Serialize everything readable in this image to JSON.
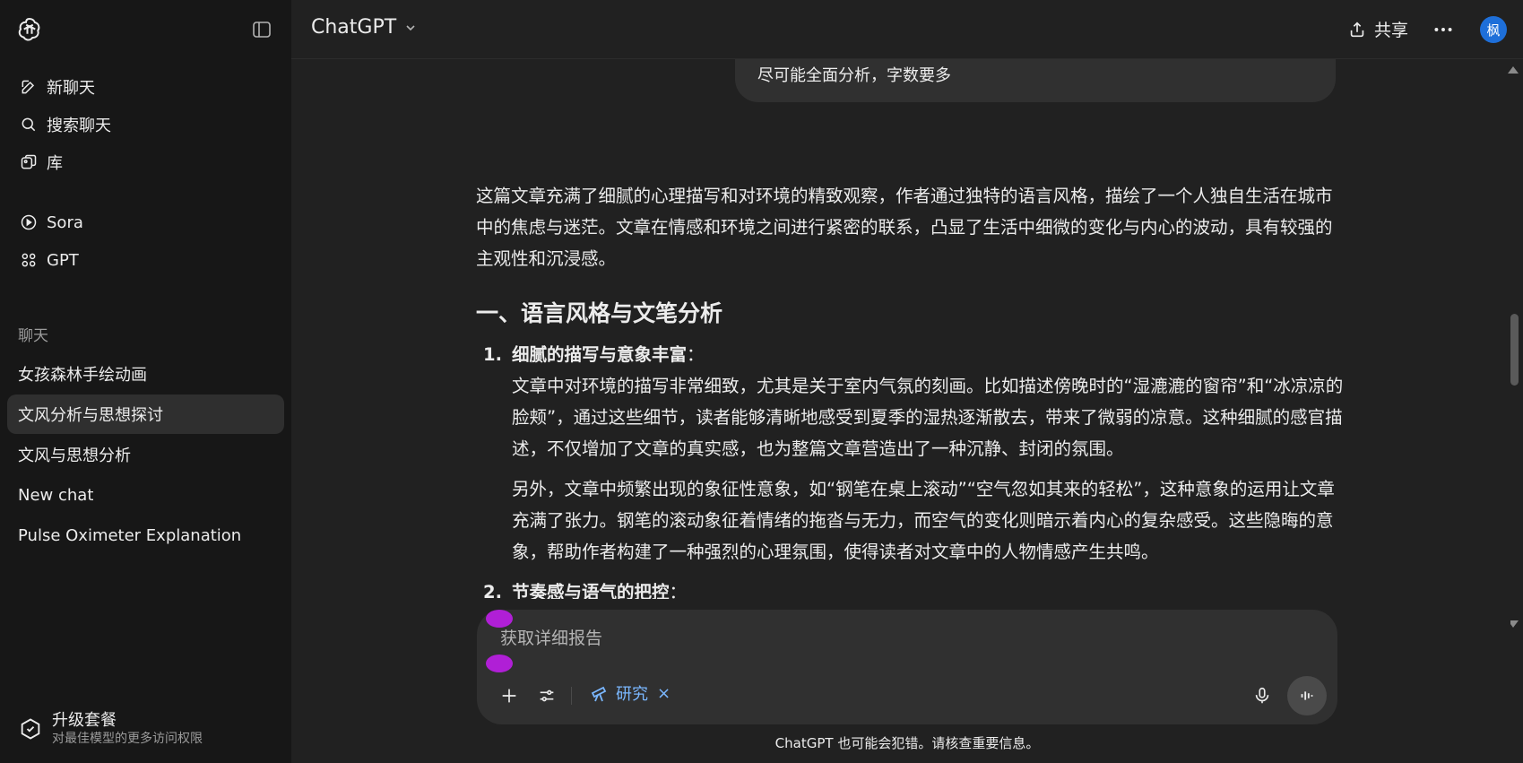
{
  "sidebar": {
    "logo_icon": "openai-logo-icon",
    "toggle_icon": "sidebar-toggle-icon",
    "nav": [
      {
        "label": "新聊天",
        "icon": "edit-icon"
      },
      {
        "label": "搜索聊天",
        "icon": "search-icon"
      },
      {
        "label": "库",
        "icon": "library-icon"
      },
      {
        "label": "Sora",
        "icon": "play-circle-icon"
      },
      {
        "label": "GPT",
        "icon": "grid-icon"
      }
    ],
    "section_title": "聊天",
    "chats": [
      {
        "label": "女孩森林手绘动画"
      },
      {
        "label": "文风分析与思想探讨"
      },
      {
        "label": "文风与思想分析"
      },
      {
        "label": "New chat"
      },
      {
        "label": "Pulse Oximeter Explanation"
      }
    ],
    "upgrade": {
      "title": "升级套餐",
      "subtitle": "对最佳模型的更多访问权限"
    }
  },
  "header": {
    "model_name": "ChatGPT",
    "share_label": "共享",
    "avatar_text": "枫"
  },
  "conversation": {
    "user_message": "尽可能全面分析，字数要多",
    "intro": "这篇文章充满了细腻的心理描写和对环境的精致观察，作者通过独特的语言风格，描绘了一个人独自生活在城市中的焦虑与迷茫。文章在情感和环境之间进行紧密的联系，凸显了生活中细微的变化与内心的波动，具有较强的主观性和沉浸感。",
    "heading": "一、语言风格与文笔分析",
    "items": [
      {
        "num": "1.",
        "title": "细腻的描写与意象丰富",
        "paragraphs": [
          "文章中对环境的描写非常细致，尤其是关于室内气氛的刻画。比如描述傍晚时的“湿漉漉的窗帘”和“冰凉凉的脸颊”，通过这些细节，读者能够清晰地感受到夏季的湿热逐渐散去，带来了微弱的凉意。这种细腻的感官描述，不仅增加了文章的真实感，也为整篇文章营造出了一种沉静、封闭的氛围。",
          "另外，文章中频繁出现的象征性意象，如“钢笔在桌上滚动”“空气忽如其来的轻松”，这种意象的运用让文章充满了张力。钢笔的滚动象征着情绪的拖沓与无力，而空气的变化则暗示着内心的复杂感受。这些隐晦的意象，帮助作者构建了一种强烈的心理氛围，使得读者对文章中的人物情感产生共鸣。"
        ]
      },
      {
        "num": "2.",
        "title": "节奏感与语气的把控",
        "paragraphs": []
      }
    ]
  },
  "composer": {
    "placeholder": "获取详细报告",
    "research_label": "研究",
    "close_glyph": "×"
  },
  "disclaimer": "ChatGPT 也可能会犯错。请核查重要信息。",
  "colors": {
    "background": "#212121",
    "sidebar": "#171717",
    "accent": "#7ab7ff",
    "avatar": "#1e6fd9"
  }
}
